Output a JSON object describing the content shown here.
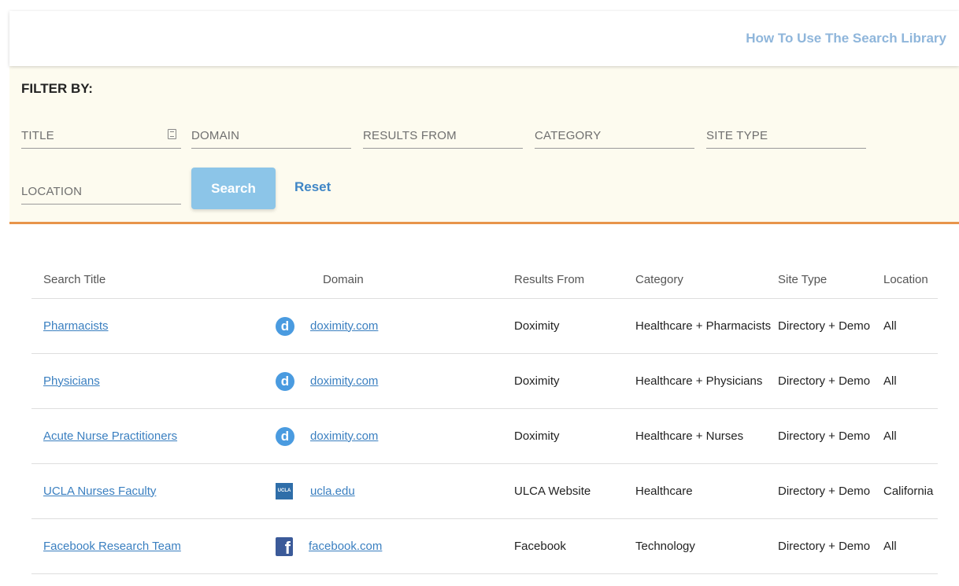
{
  "header": {
    "help_link": "How To Use The Search Library"
  },
  "filter": {
    "title": "FILTER BY:",
    "fields": {
      "title": "TITLE",
      "domain": "DOMAIN",
      "results_from": "RESULTS FROM",
      "category": "CATEGORY",
      "site_type": "SITE TYPE",
      "location": "LOCATION"
    },
    "search_label": "Search",
    "reset_label": "Reset"
  },
  "table": {
    "headers": [
      "Search Title",
      "Domain",
      "Results From",
      "Category",
      "Site Type",
      "Location"
    ],
    "rows": [
      {
        "title": "Pharmacists",
        "icon": "doximity-icon",
        "icon_text": "d",
        "domain": "doximity.com",
        "results_from": "Doximity",
        "category": "Healthcare + Pharmacists",
        "site_type": "Directory + Demo",
        "location": "All"
      },
      {
        "title": "Physicians",
        "icon": "doximity-icon",
        "icon_text": "d",
        "domain": "doximity.com",
        "results_from": "Doximity",
        "category": "Healthcare + Physicians",
        "site_type": "Directory + Demo",
        "location": "All"
      },
      {
        "title": "Acute Nurse Practitioners",
        "icon": "doximity-icon",
        "icon_text": "d",
        "domain": "doximity.com",
        "results_from": "Doximity",
        "category": "Healthcare + Nurses",
        "site_type": "Directory + Demo",
        "location": "All"
      },
      {
        "title": "UCLA Nurses Faculty",
        "icon": "ucla-icon",
        "icon_text": "UCLA",
        "domain": "ucla.edu",
        "results_from": "ULCA Website",
        "category": "Healthcare",
        "site_type": "Directory + Demo",
        "location": "California"
      },
      {
        "title": "Facebook Research Team",
        "icon": "facebook-icon",
        "icon_text": "f",
        "domain": "facebook.com",
        "results_from": "Facebook",
        "category": "Technology",
        "site_type": "Directory + Demo",
        "location": "All"
      }
    ]
  },
  "colors": {
    "accent": "#3a7fc0",
    "filter_bg": "#fdfbef",
    "divider": "#e8944a",
    "button": "#8cc5e8"
  }
}
